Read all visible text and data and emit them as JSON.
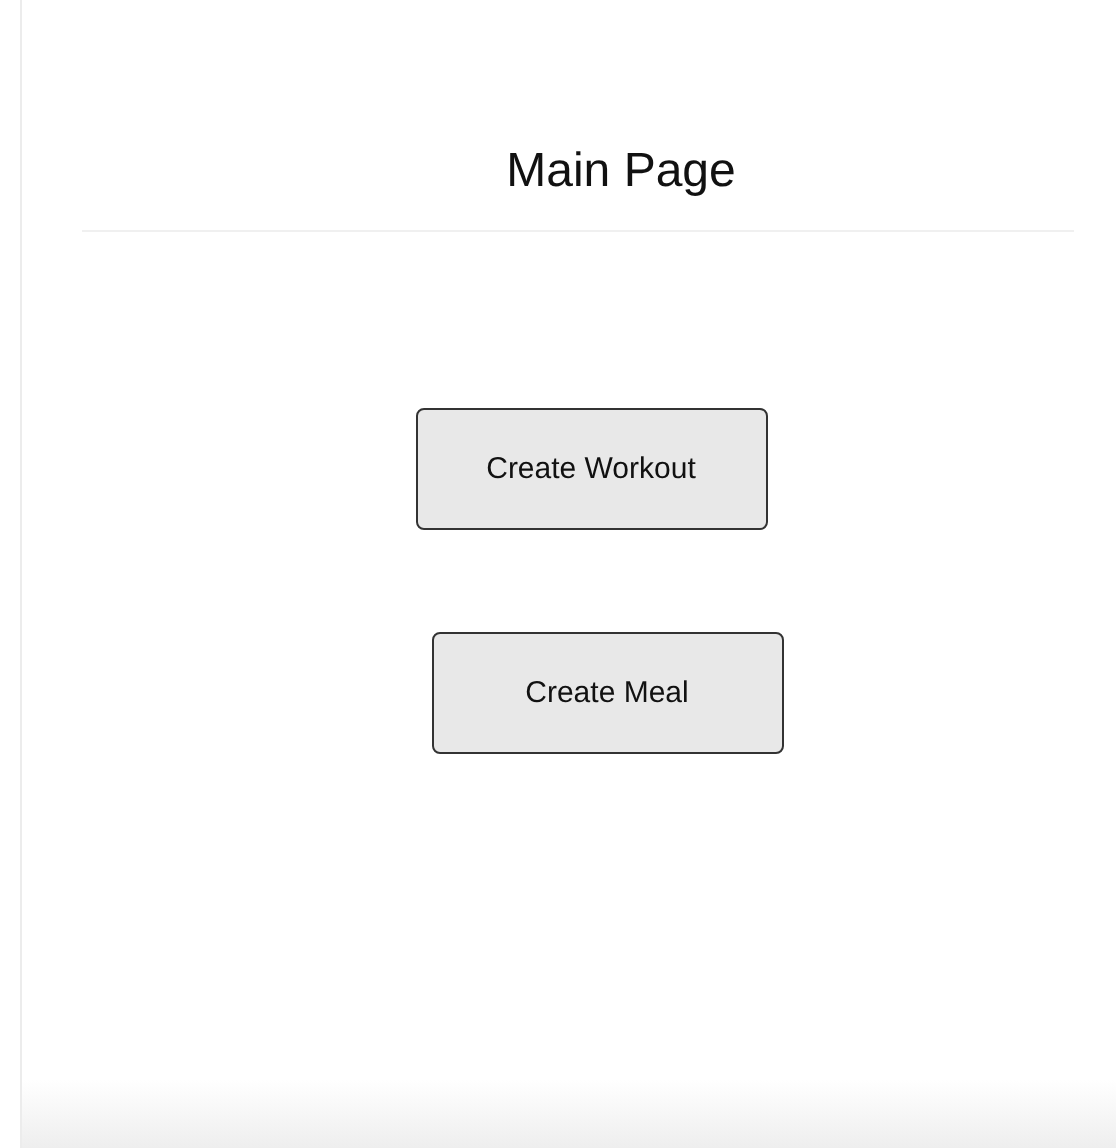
{
  "header": {
    "title": "Main Page"
  },
  "buttons": [
    {
      "label": "Create Workout"
    },
    {
      "label": "Create Meal"
    }
  ]
}
